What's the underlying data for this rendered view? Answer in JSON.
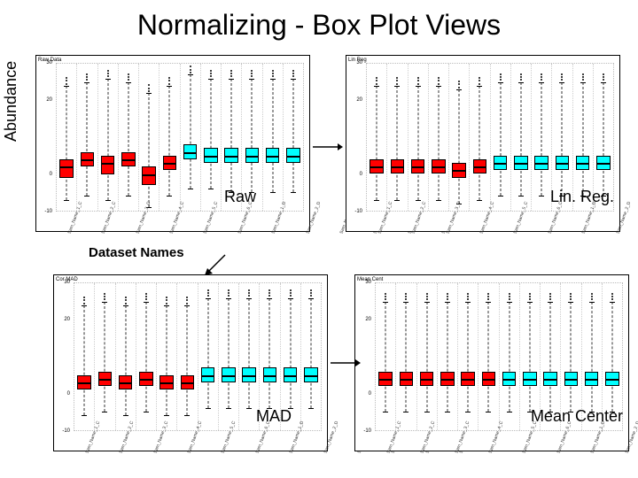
{
  "title": "Normalizing - Box Plot Views",
  "ylabel": "Abundance",
  "dataset_names_label": "Dataset Names",
  "panel_labels": {
    "raw": "Raw",
    "linreg": "Lin. Reg.",
    "mad": "MAD",
    "mean_center": "Mean Center"
  },
  "chart_data": [
    {
      "id": "raw",
      "tiny_label": "Raw Data",
      "x_categories": [
        "Sam_Name_1_C",
        "Sam_Name_2_C",
        "Sam_Name_3_C",
        "Sam_Name_4_C",
        "Sam_Name_5_C",
        "Sam_Name_6_C",
        "Sam_Name_1_D",
        "Sam_Name_2_D",
        "Sam_Name_3_D",
        "Sam_Name_4_D",
        "Sam_Name_5_D",
        "Sam_Name_6_D"
      ],
      "ylim": [
        -10,
        30
      ],
      "yticks": [
        -10,
        0,
        20,
        30
      ],
      "series": [
        {
          "color": "red",
          "median": 2,
          "q1": -1,
          "q3": 4,
          "low": -7,
          "high": 24
        },
        {
          "color": "red",
          "median": 4,
          "q1": 2,
          "q3": 6,
          "low": -6,
          "high": 25
        },
        {
          "color": "red",
          "median": 3,
          "q1": 0,
          "q3": 5,
          "low": -7,
          "high": 26
        },
        {
          "color": "red",
          "median": 4,
          "q1": 2,
          "q3": 6,
          "low": -6,
          "high": 25
        },
        {
          "color": "red",
          "median": 0,
          "q1": -3,
          "q3": 2,
          "low": -9,
          "high": 22
        },
        {
          "color": "red",
          "median": 3,
          "q1": 1,
          "q3": 5,
          "low": -6,
          "high": 24
        },
        {
          "color": "cyan",
          "median": 6,
          "q1": 4,
          "q3": 8,
          "low": -4,
          "high": 27
        },
        {
          "color": "cyan",
          "median": 5,
          "q1": 3,
          "q3": 7,
          "low": -4,
          "high": 26
        },
        {
          "color": "cyan",
          "median": 5,
          "q1": 3,
          "q3": 7,
          "low": -5,
          "high": 26
        },
        {
          "color": "cyan",
          "median": 5,
          "q1": 3,
          "q3": 7,
          "low": -5,
          "high": 26
        },
        {
          "color": "cyan",
          "median": 5,
          "q1": 3,
          "q3": 7,
          "low": -5,
          "high": 26
        },
        {
          "color": "cyan",
          "median": 5,
          "q1": 3,
          "q3": 7,
          "low": -5,
          "high": 26
        }
      ]
    },
    {
      "id": "linreg",
      "tiny_label": "Lin Reg",
      "x_categories": [
        "Sam_Name_1_C",
        "Sam_Name_2_C",
        "Sam_Name_3_C",
        "Sam_Name_4_C",
        "Sam_Name_5_C",
        "Sam_Name_6_C",
        "Sam_Name_1_D",
        "Sam_Name_2_D",
        "Sam_Name_3_D",
        "Sam_Name_4_D",
        "Sam_Name_5_D",
        "Sam_Name_6_D"
      ],
      "ylim": [
        -10,
        30
      ],
      "yticks": [
        -10,
        0,
        20,
        30
      ],
      "series": [
        {
          "color": "red",
          "median": 2,
          "q1": 0,
          "q3": 4,
          "low": -7,
          "high": 24
        },
        {
          "color": "red",
          "median": 2,
          "q1": 0,
          "q3": 4,
          "low": -7,
          "high": 24
        },
        {
          "color": "red",
          "median": 2,
          "q1": 0,
          "q3": 4,
          "low": -7,
          "high": 24
        },
        {
          "color": "red",
          "median": 2,
          "q1": 0,
          "q3": 4,
          "low": -7,
          "high": 24
        },
        {
          "color": "red",
          "median": 1,
          "q1": -1,
          "q3": 3,
          "low": -8,
          "high": 23
        },
        {
          "color": "red",
          "median": 2,
          "q1": 0,
          "q3": 4,
          "low": -7,
          "high": 24
        },
        {
          "color": "cyan",
          "median": 3,
          "q1": 1,
          "q3": 5,
          "low": -6,
          "high": 25
        },
        {
          "color": "cyan",
          "median": 3,
          "q1": 1,
          "q3": 5,
          "low": -6,
          "high": 25
        },
        {
          "color": "cyan",
          "median": 3,
          "q1": 1,
          "q3": 5,
          "low": -6,
          "high": 25
        },
        {
          "color": "cyan",
          "median": 3,
          "q1": 1,
          "q3": 5,
          "low": -6,
          "high": 25
        },
        {
          "color": "cyan",
          "median": 3,
          "q1": 1,
          "q3": 5,
          "low": -6,
          "high": 25
        },
        {
          "color": "cyan",
          "median": 3,
          "q1": 1,
          "q3": 5,
          "low": -6,
          "high": 25
        }
      ]
    },
    {
      "id": "mad",
      "tiny_label": "Cor MAD",
      "x_categories": [
        "Sam_Name_1_C",
        "Sam_Name_2_C",
        "Sam_Name_3_C",
        "Sam_Name_4_C",
        "Sam_Name_5_C",
        "Sam_Name_6_C",
        "Sam_Name_1_D",
        "Sam_Name_2_D",
        "Sam_Name_3_D",
        "Sam_Name_4_D",
        "Sam_Name_5_D",
        "Sam_Name_6_D"
      ],
      "ylim": [
        -10,
        30
      ],
      "yticks": [
        -10,
        0,
        20,
        30
      ],
      "series": [
        {
          "color": "red",
          "median": 3,
          "q1": 1,
          "q3": 5,
          "low": -6,
          "high": 24
        },
        {
          "color": "red",
          "median": 4,
          "q1": 2,
          "q3": 6,
          "low": -5,
          "high": 25
        },
        {
          "color": "red",
          "median": 3,
          "q1": 1,
          "q3": 5,
          "low": -6,
          "high": 24
        },
        {
          "color": "red",
          "median": 4,
          "q1": 2,
          "q3": 6,
          "low": -5,
          "high": 25
        },
        {
          "color": "red",
          "median": 3,
          "q1": 1,
          "q3": 5,
          "low": -6,
          "high": 24
        },
        {
          "color": "red",
          "median": 3,
          "q1": 1,
          "q3": 5,
          "low": -6,
          "high": 24
        },
        {
          "color": "cyan",
          "median": 5,
          "q1": 3,
          "q3": 7,
          "low": -4,
          "high": 26
        },
        {
          "color": "cyan",
          "median": 5,
          "q1": 3,
          "q3": 7,
          "low": -4,
          "high": 26
        },
        {
          "color": "cyan",
          "median": 5,
          "q1": 3,
          "q3": 7,
          "low": -4,
          "high": 26
        },
        {
          "color": "cyan",
          "median": 5,
          "q1": 3,
          "q3": 7,
          "low": -4,
          "high": 26
        },
        {
          "color": "cyan",
          "median": 5,
          "q1": 3,
          "q3": 7,
          "low": -4,
          "high": 26
        },
        {
          "color": "cyan",
          "median": 5,
          "q1": 3,
          "q3": 7,
          "low": -4,
          "high": 26
        }
      ]
    },
    {
      "id": "mean_center",
      "tiny_label": "Mean Cent",
      "x_categories": [
        "Sam_Name_1_C",
        "Sam_Name_2_C",
        "Sam_Name_3_C",
        "Sam_Name_4_C",
        "Sam_Name_5_C",
        "Sam_Name_6_C",
        "Sam_Name_1_D",
        "Sam_Name_2_D",
        "Sam_Name_3_D",
        "Sam_Name_4_D",
        "Sam_Name_5_D",
        "Sam_Name_6_D"
      ],
      "ylim": [
        -10,
        30
      ],
      "yticks": [
        -10,
        0,
        20,
        30
      ],
      "series": [
        {
          "color": "red",
          "median": 4,
          "q1": 2,
          "q3": 6,
          "low": -5,
          "high": 25
        },
        {
          "color": "red",
          "median": 4,
          "q1": 2,
          "q3": 6,
          "low": -5,
          "high": 25
        },
        {
          "color": "red",
          "median": 4,
          "q1": 2,
          "q3": 6,
          "low": -5,
          "high": 25
        },
        {
          "color": "red",
          "median": 4,
          "q1": 2,
          "q3": 6,
          "low": -5,
          "high": 25
        },
        {
          "color": "red",
          "median": 4,
          "q1": 2,
          "q3": 6,
          "low": -5,
          "high": 25
        },
        {
          "color": "red",
          "median": 4,
          "q1": 2,
          "q3": 6,
          "low": -5,
          "high": 25
        },
        {
          "color": "cyan",
          "median": 4,
          "q1": 2,
          "q3": 6,
          "low": -5,
          "high": 25
        },
        {
          "color": "cyan",
          "median": 4,
          "q1": 2,
          "q3": 6,
          "low": -5,
          "high": 25
        },
        {
          "color": "cyan",
          "median": 4,
          "q1": 2,
          "q3": 6,
          "low": -5,
          "high": 25
        },
        {
          "color": "cyan",
          "median": 4,
          "q1": 2,
          "q3": 6,
          "low": -5,
          "high": 25
        },
        {
          "color": "cyan",
          "median": 4,
          "q1": 2,
          "q3": 6,
          "low": -5,
          "high": 25
        },
        {
          "color": "cyan",
          "median": 4,
          "q1": 2,
          "q3": 6,
          "low": -5,
          "high": 25
        }
      ]
    }
  ]
}
